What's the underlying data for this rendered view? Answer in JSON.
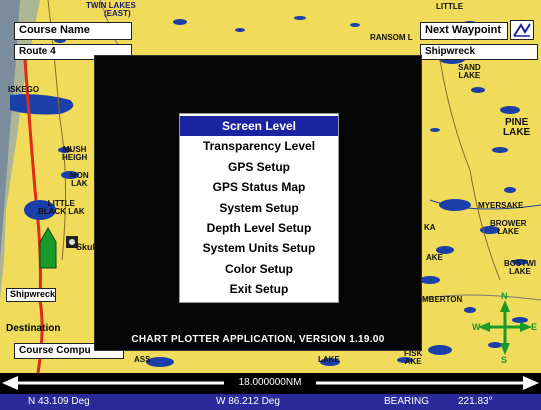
{
  "map": {
    "course_name_label": "Course Name",
    "course_name_value": "Route 4",
    "next_waypoint_label": "Next Waypoint",
    "next_waypoint_value": "Shipwreck",
    "destination_label": "Destination",
    "course_computed_label": "Course Compu",
    "shipwreck_label": "Shipwreck",
    "skull_label": "Skul",
    "labels": {
      "twin_lakes": "TWIN LAKES",
      "twin_lakes_sub": "(EAST)",
      "ransom": "RANSOM L",
      "little": "LITTLE",
      "sand_lake": "SAND\nLAKE",
      "pine_lake": "PINE\nLAKE",
      "muskegon": "ISKEGO",
      "mush_heigh": "MUSH\nHEIGH",
      "mon_lak": "MON\nLAK",
      "little_black_lak": "LITTLE\nBLACK LAK",
      "myersake": "MYERSAKE",
      "brower_lake": "BROWER\nLAKE",
      "ka": "KA",
      "ake": "AKE",
      "bostwi_lake": "BOSTWI\nLAKE",
      "mberton": "MBERTON",
      "lake_bottom": "LAKE",
      "fisk_ake": "FISK\nAKE",
      "ass": "ASS"
    },
    "compass_labels": {
      "n": "N",
      "s": "S",
      "e": "E",
      "w": "W"
    }
  },
  "dialog": {
    "menu_items": [
      "Screen Level",
      "Transparency Level",
      "GPS Setup",
      "GPS Status Map",
      "System Setup",
      "Depth Level Setup",
      "System Units Setup",
      "Color Setup",
      "Exit Setup"
    ],
    "selected_index": 0,
    "version_text": "CHART PLOTTER APPLICATION, VERSION  1.19.00"
  },
  "scale": {
    "text": "18.000000NM"
  },
  "status": {
    "latitude": "N  43.109 Deg",
    "longitude": "W  86.212 Deg",
    "bearing_label": "BEARING",
    "bearing_value": "221.83°"
  },
  "colors": {
    "land": "#f0dc5a",
    "water": "#1a3fa8",
    "highlight": "#1a24a0",
    "status_bar": "#2a2a9a",
    "road": "#e02a1a",
    "compass": "#1a9a2a"
  }
}
